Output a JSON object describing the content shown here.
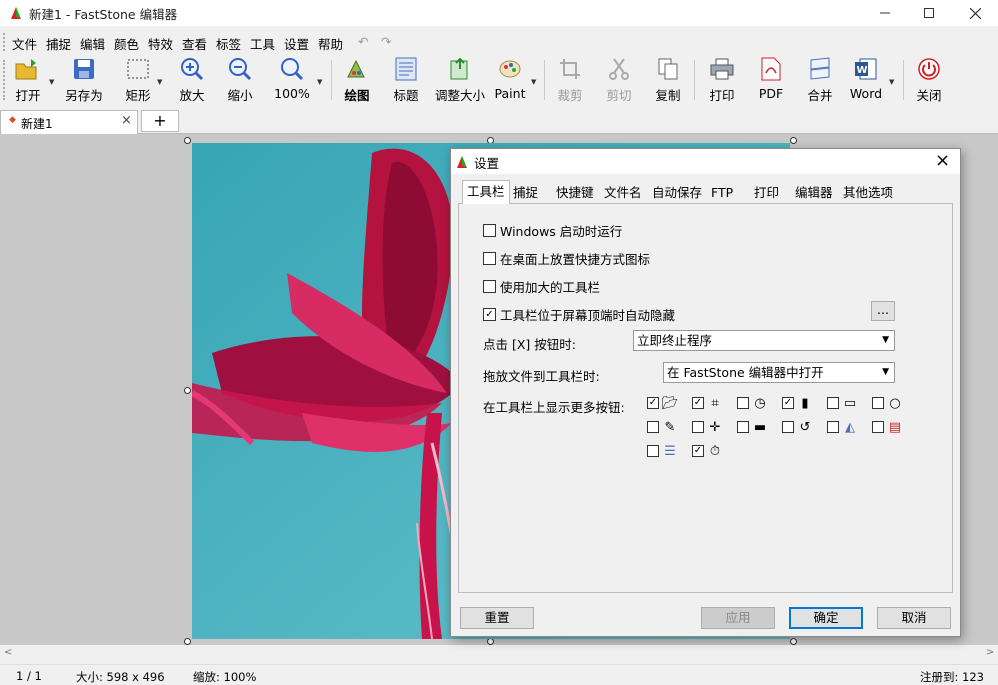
{
  "window": {
    "title": "新建1 - FastStone 编辑器"
  },
  "menu": [
    "文件",
    "捕捉",
    "编辑",
    "颜色",
    "特效",
    "查看",
    "标签",
    "工具",
    "设置",
    "帮助"
  ],
  "toolbar": {
    "open": "打开",
    "save_as": "另存为",
    "rect": "矩形",
    "zoom_in": "放大",
    "zoom_out": "缩小",
    "zoom_100": "100%",
    "draw": "绘图",
    "caption": "标题",
    "resize": "调整大小",
    "paint": "Paint",
    "crop": "裁剪",
    "cut": "剪切",
    "copy": "复制",
    "print": "打印",
    "pdf": "PDF",
    "merge": "合并",
    "word": "Word",
    "close": "关闭"
  },
  "tabs": {
    "doc": "新建1",
    "add": "+"
  },
  "status": {
    "page": "1 / 1",
    "size": "大小: 598 x 496",
    "zoom": "缩放: 100%",
    "reg": "注册到: 123"
  },
  "dialog": {
    "title": "设置",
    "tabs": [
      "工具栏",
      "捕捉",
      "快捷键",
      "文件名",
      "自动保存",
      "FTP",
      "打印",
      "编辑器",
      "其他选项"
    ],
    "opt_startup": "Windows 启动时运行",
    "opt_shortcut": "在桌面上放置快捷方式图标",
    "opt_large": "使用加大的工具栏",
    "opt_autohide": "工具栏位于屏幕顶端时自动隐藏",
    "more_btn": "...",
    "close_label": "点击 [X] 按钮时:",
    "close_value": "立即终止程序",
    "drag_label": "拖放文件到工具栏时:",
    "drag_value": "在 FastStone 编辑器中打开",
    "more_buttons_label": "在工具栏上显示更多按钮:",
    "btn_reset": "重置",
    "btn_apply": "应用",
    "btn_ok": "确定",
    "btn_cancel": "取消"
  },
  "colors": {
    "accent": "#0078d7",
    "close_red": "#d62020"
  }
}
